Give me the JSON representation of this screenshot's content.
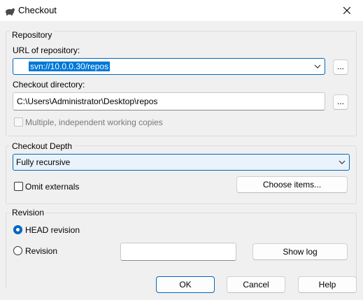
{
  "window": {
    "title": "Checkout",
    "app_icon": "tortoise-icon",
    "close_icon": "close-icon"
  },
  "repository": {
    "group_label": "Repository",
    "url_label": "URL of repository:",
    "url_value": "svn://10.0.0.30/repos",
    "browse_url_label": "...",
    "dir_label": "Checkout directory:",
    "dir_value": "C:\\Users\\Administrator\\Desktop\\repos",
    "browse_dir_label": "...",
    "multiple_label": "Multiple, independent working copies",
    "multiple_checked": false,
    "multiple_disabled": true
  },
  "depth": {
    "group_label": "Checkout Depth",
    "selected": "Fully recursive",
    "omit_label": "Omit externals",
    "omit_checked": false,
    "choose_items_label": "Choose items..."
  },
  "revision": {
    "group_label": "Revision",
    "head_label": "HEAD revision",
    "head_selected": true,
    "revision_label": "Revision",
    "revision_value": "",
    "show_log_label": "Show log"
  },
  "buttons": {
    "ok": "OK",
    "cancel": "Cancel",
    "help": "Help"
  },
  "colors": {
    "accent": "#0067c0",
    "selection": "#0078d7",
    "background": "#f0f0f0"
  }
}
